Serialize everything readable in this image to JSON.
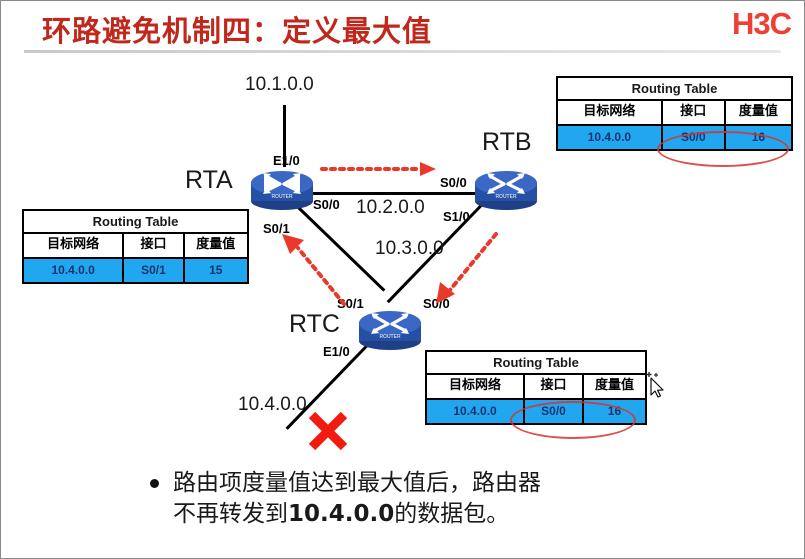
{
  "header": {
    "title": "环路避免机制四：定义最大值",
    "logo": "H3C"
  },
  "diagram": {
    "networks": {
      "top": "10.1.0.0",
      "rta_rtb": "10.2.0.0",
      "rtb_rtc": "10.3.0.0",
      "down": "10.4.0.0"
    },
    "routers": [
      {
        "name": "RTA",
        "interfaces": [
          "E1/0",
          "S0/0",
          "S0/1"
        ]
      },
      {
        "name": "RTB",
        "interfaces": [
          "S0/0",
          "S1/0"
        ]
      },
      {
        "name": "RTC",
        "interfaces": [
          "S0/1",
          "S0/0",
          "E1/0"
        ]
      }
    ],
    "interface_labels": {
      "rta_e10": "E1/0",
      "rta_s00": "S0/0",
      "rta_s01": "S0/1",
      "rtb_s00": "S0/0",
      "rtb_s10": "S1/0",
      "rtc_s01": "S0/1",
      "rtc_s00": "S0/0",
      "rtc_e10": "E1/0"
    },
    "link_failure_marker": "red-x"
  },
  "routing_tables": {
    "columns": [
      "目标网络",
      "接口",
      "度量值"
    ],
    "title": "Routing Table",
    "rtb": {
      "title": "Routing Table",
      "columns": [
        "目标网络",
        "接口",
        "度量值"
      ],
      "row": [
        "10.4.0.0",
        "S0/0",
        "16"
      ],
      "highlighted": true
    },
    "rta": {
      "title": "Routing Table",
      "columns": [
        "目标网络",
        "接口",
        "度量值"
      ],
      "row": [
        "10.4.0.0",
        "S0/1",
        "15"
      ],
      "highlighted": false
    },
    "rtc": {
      "title": "Routing Table",
      "columns": [
        "目标网络",
        "接口",
        "度量值"
      ],
      "row": [
        "10.4.0.0",
        "S0/0",
        "16"
      ],
      "highlighted": true
    }
  },
  "bullet": {
    "line1": "路由项度量值达到最大值后，路由器",
    "line2_pre": "不再转发到",
    "line2_addr": "10.4.0.0",
    "line2_post": "的数据包。"
  },
  "colors": {
    "title": "#c0281c",
    "logo": "#ef3e33",
    "table_row": "#21a7f0",
    "annotation": "#d8332a",
    "link": "#000000"
  }
}
